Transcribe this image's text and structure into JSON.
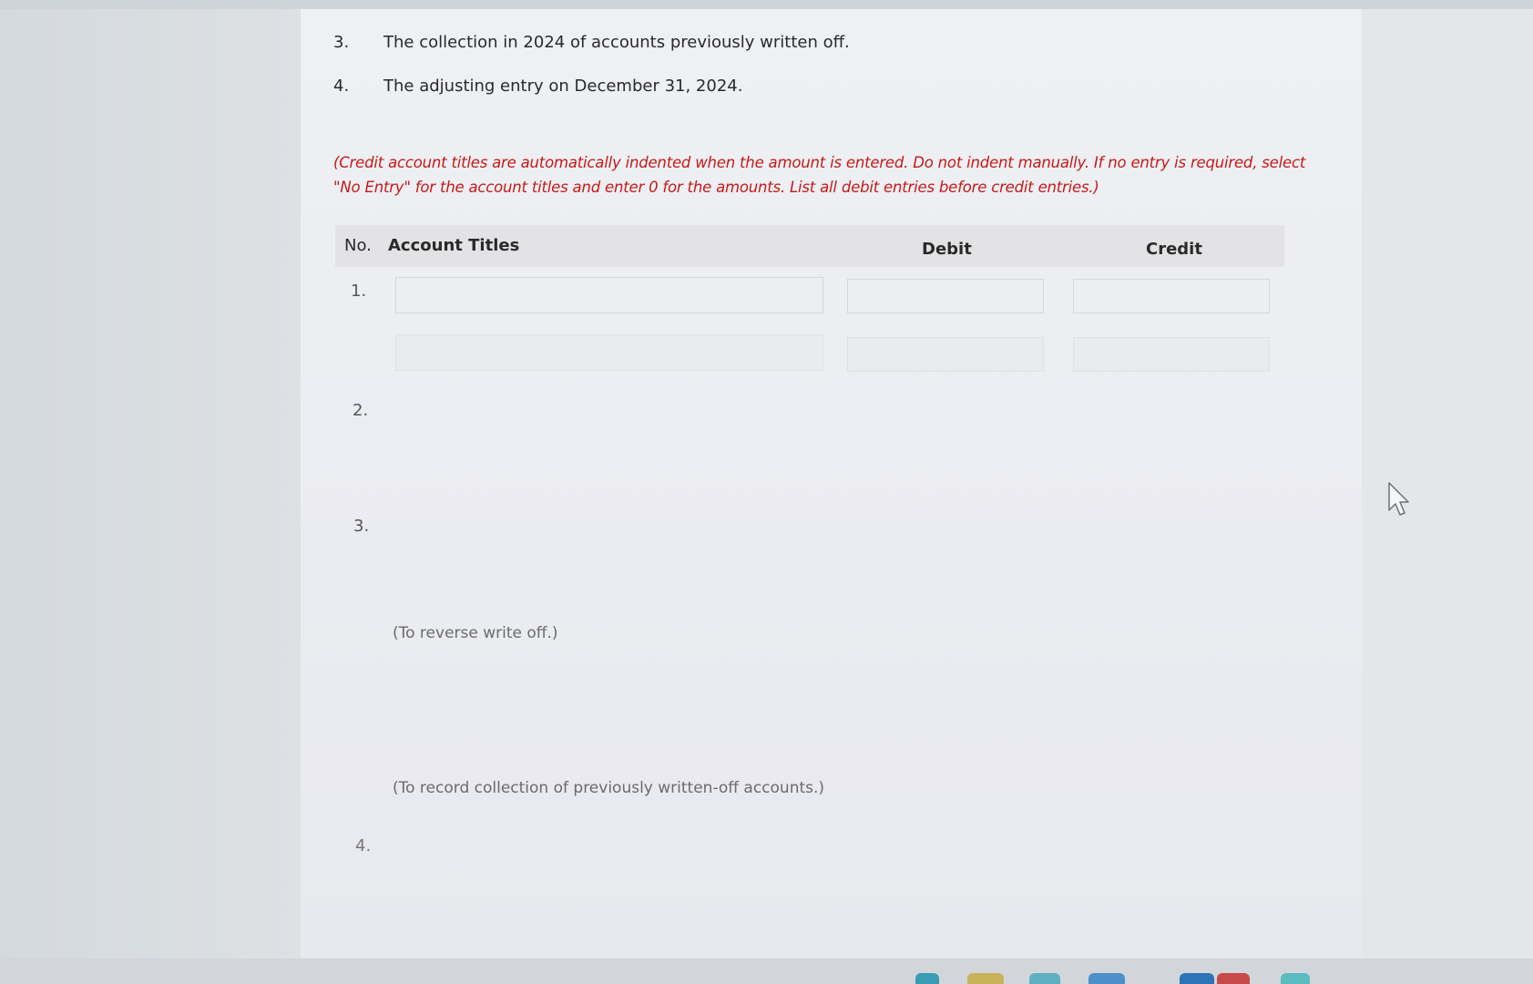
{
  "questions": [
    {
      "num": "3.",
      "text": "The collection in 2024 of accounts previously written off."
    },
    {
      "num": "4.",
      "text": "The adjusting entry on December 31, 2024."
    }
  ],
  "instructions": "(Credit account titles are automatically indented when the amount is entered. Do not indent manually. If no entry is required, select \"No Entry\" for the account titles and enter 0 for the amounts. List all debit entries before credit entries.)",
  "table": {
    "headers": {
      "no": "No.",
      "account_titles": "Account Titles",
      "debit": "Debit",
      "credit": "Credit"
    },
    "entries": [
      {
        "num": "1."
      },
      {
        "num": "2."
      },
      {
        "num": "3."
      },
      {
        "num": "4."
      }
    ],
    "notes": {
      "reverse": "(To reverse write off.)",
      "collection": "(To record collection of previously written-off accounts.)"
    }
  },
  "colors": {
    "instruction_red": "#c41a1a",
    "page_bg": "#eef0f3"
  }
}
